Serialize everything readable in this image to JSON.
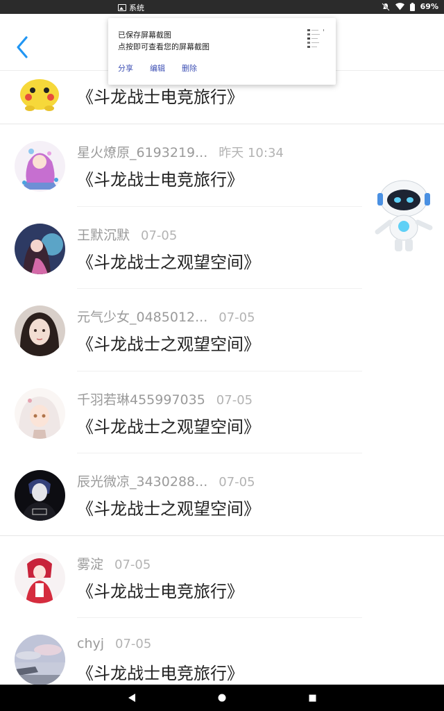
{
  "status_bar": {
    "notification_label": "系统",
    "battery": "69%"
  },
  "toast": {
    "line1": "已保存屏幕截图",
    "line2": "点按即可查看您的屏幕截图",
    "actions": [
      "分享",
      "编辑",
      "删除"
    ]
  },
  "list": {
    "items": [
      {
        "name": "",
        "time": "",
        "title": "《斗龙战士电竞旅行》",
        "avatar": "pikachu"
      },
      {
        "name": "星火燎原_6193219...",
        "time": "昨天 10:34",
        "title": "《斗龙战士电竞旅行》",
        "avatar": "magical-girl"
      },
      {
        "name": "王默沉默",
        "time": "07-05",
        "title": "《斗龙战士之观望空间》",
        "avatar": "anime-couple"
      },
      {
        "name": "元气少女_0485012...",
        "time": "07-05",
        "title": "《斗龙战士之观望空间》",
        "avatar": "girl-photo"
      },
      {
        "name": "千羽若琳455997035",
        "time": "07-05",
        "title": "《斗龙战士之观望空间》",
        "avatar": "white-hair-girl"
      },
      {
        "name": "辰光微凉_3430288...",
        "time": "07-05",
        "title": "《斗龙战士之观望空间》",
        "avatar": "dark-boy"
      },
      {
        "name": "雾淀",
        "time": "07-05",
        "title": "《斗龙战士电竞旅行》",
        "avatar": "red-girl"
      },
      {
        "name": "chyj",
        "time": "07-05",
        "title": "《斗龙战士电竞旅行》",
        "avatar": "sky-photo"
      }
    ]
  },
  "colors": {
    "accent": "#2196f3",
    "status_bar": "#2b2b2b",
    "nav_bar": "#000000",
    "toast_action": "#3f51b5"
  }
}
